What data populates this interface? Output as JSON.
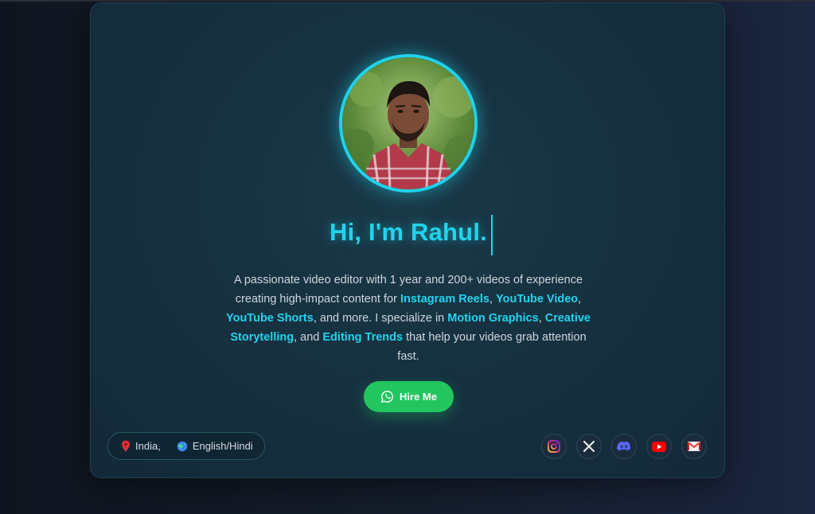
{
  "profile": {
    "greeting": "Hi, I'm Rahul.",
    "avatar_alt": "Profile photo of Rahul"
  },
  "description": {
    "t1": "A passionate video editor with 1 year and 200+ videos of experience creating high-impact content for ",
    "h1": "Instagram Reels",
    "t2": ", ",
    "h2": "YouTube Video",
    "t3": ", ",
    "h3": "YouTube Shorts",
    "t4": ", and more. I specialize in ",
    "h4": "Motion Graphics",
    "t5": ", ",
    "h5": "Creative Storytelling",
    "t6": ", and ",
    "h6": "Editing Trends",
    "t7": " that help your videos grab attention fast."
  },
  "hire_button": {
    "label": "Hire Me",
    "icon": "whatsapp-icon"
  },
  "location": {
    "country": "India,",
    "languages": "English/Hindi",
    "pin_icon": "map-pin-icon",
    "globe_icon": "globe-icon"
  },
  "socials": [
    {
      "name": "Instagram",
      "icon": "instagram-icon"
    },
    {
      "name": "X",
      "icon": "x-icon"
    },
    {
      "name": "Discord",
      "icon": "discord-icon"
    },
    {
      "name": "YouTube",
      "icon": "youtube-icon"
    },
    {
      "name": "Gmail",
      "icon": "gmail-icon"
    }
  ],
  "colors": {
    "accent": "#22d3ee",
    "button": "#22c55e",
    "text": "#cfd6de",
    "card_bg": "#163140"
  }
}
